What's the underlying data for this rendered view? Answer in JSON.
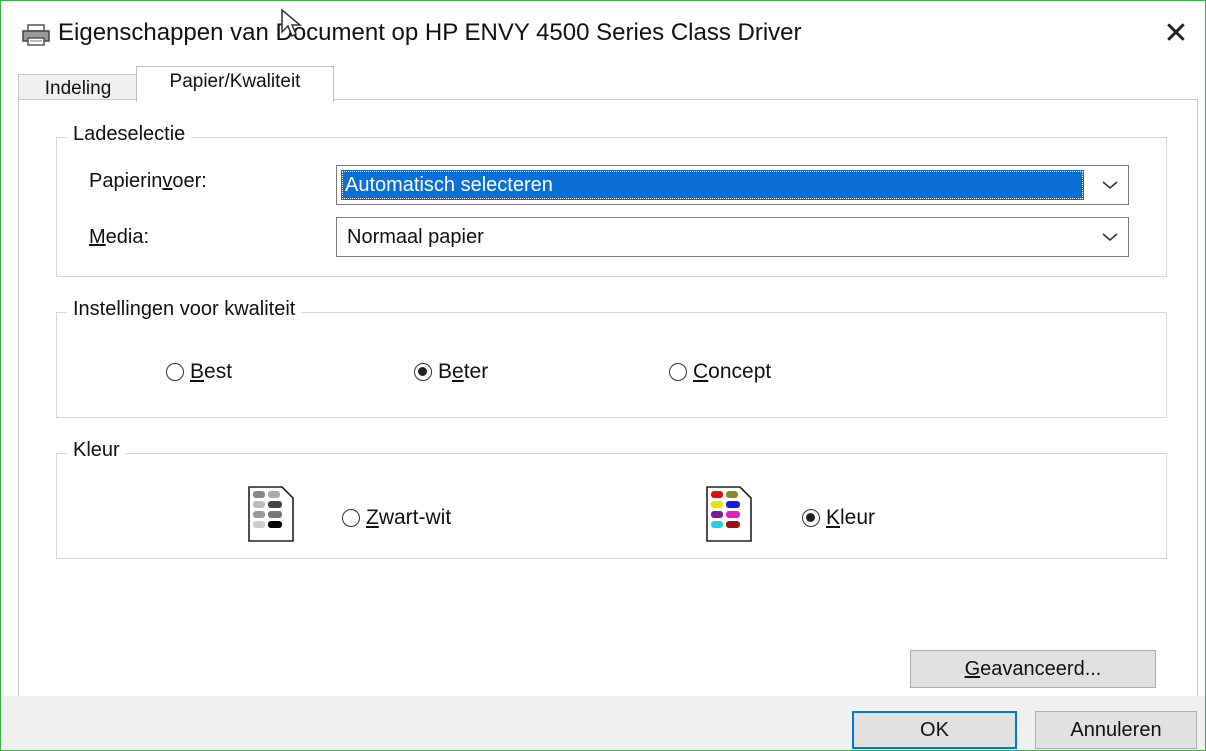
{
  "window": {
    "title": "Eigenschappen van Document op HP ENVY 4500 Series Class Driver",
    "close_symbol": "✕",
    "icon": "printer-icon"
  },
  "tabs": [
    {
      "label": "Indeling",
      "active": false
    },
    {
      "label": "Papier/Kwaliteit",
      "active": true
    }
  ],
  "tray": {
    "group_title": "Ladeselectie",
    "paper_source_label": "Papierinvoer:",
    "paper_source_value": "Automatisch selecteren",
    "media_label": "Media:",
    "media_value": "Normaal papier"
  },
  "quality": {
    "group_title": "Instellingen voor kwaliteit",
    "options": [
      {
        "label": "Best",
        "selected": false
      },
      {
        "label": "Beter",
        "selected": true
      },
      {
        "label": "Concept",
        "selected": false
      }
    ]
  },
  "color": {
    "group_title": "Kleur",
    "options": [
      {
        "label": "Zwart-wit",
        "selected": false,
        "icon": "grayscale-document-icon"
      },
      {
        "label": "Kleur",
        "selected": true,
        "icon": "color-document-icon"
      }
    ]
  },
  "buttons": {
    "advanced": "Geavanceerd...",
    "ok": "OK",
    "cancel": "Annuleren"
  },
  "colors": {
    "selection": "#0a6fd6",
    "window_border": "#3fae49",
    "button_focus": "#0078d7"
  }
}
